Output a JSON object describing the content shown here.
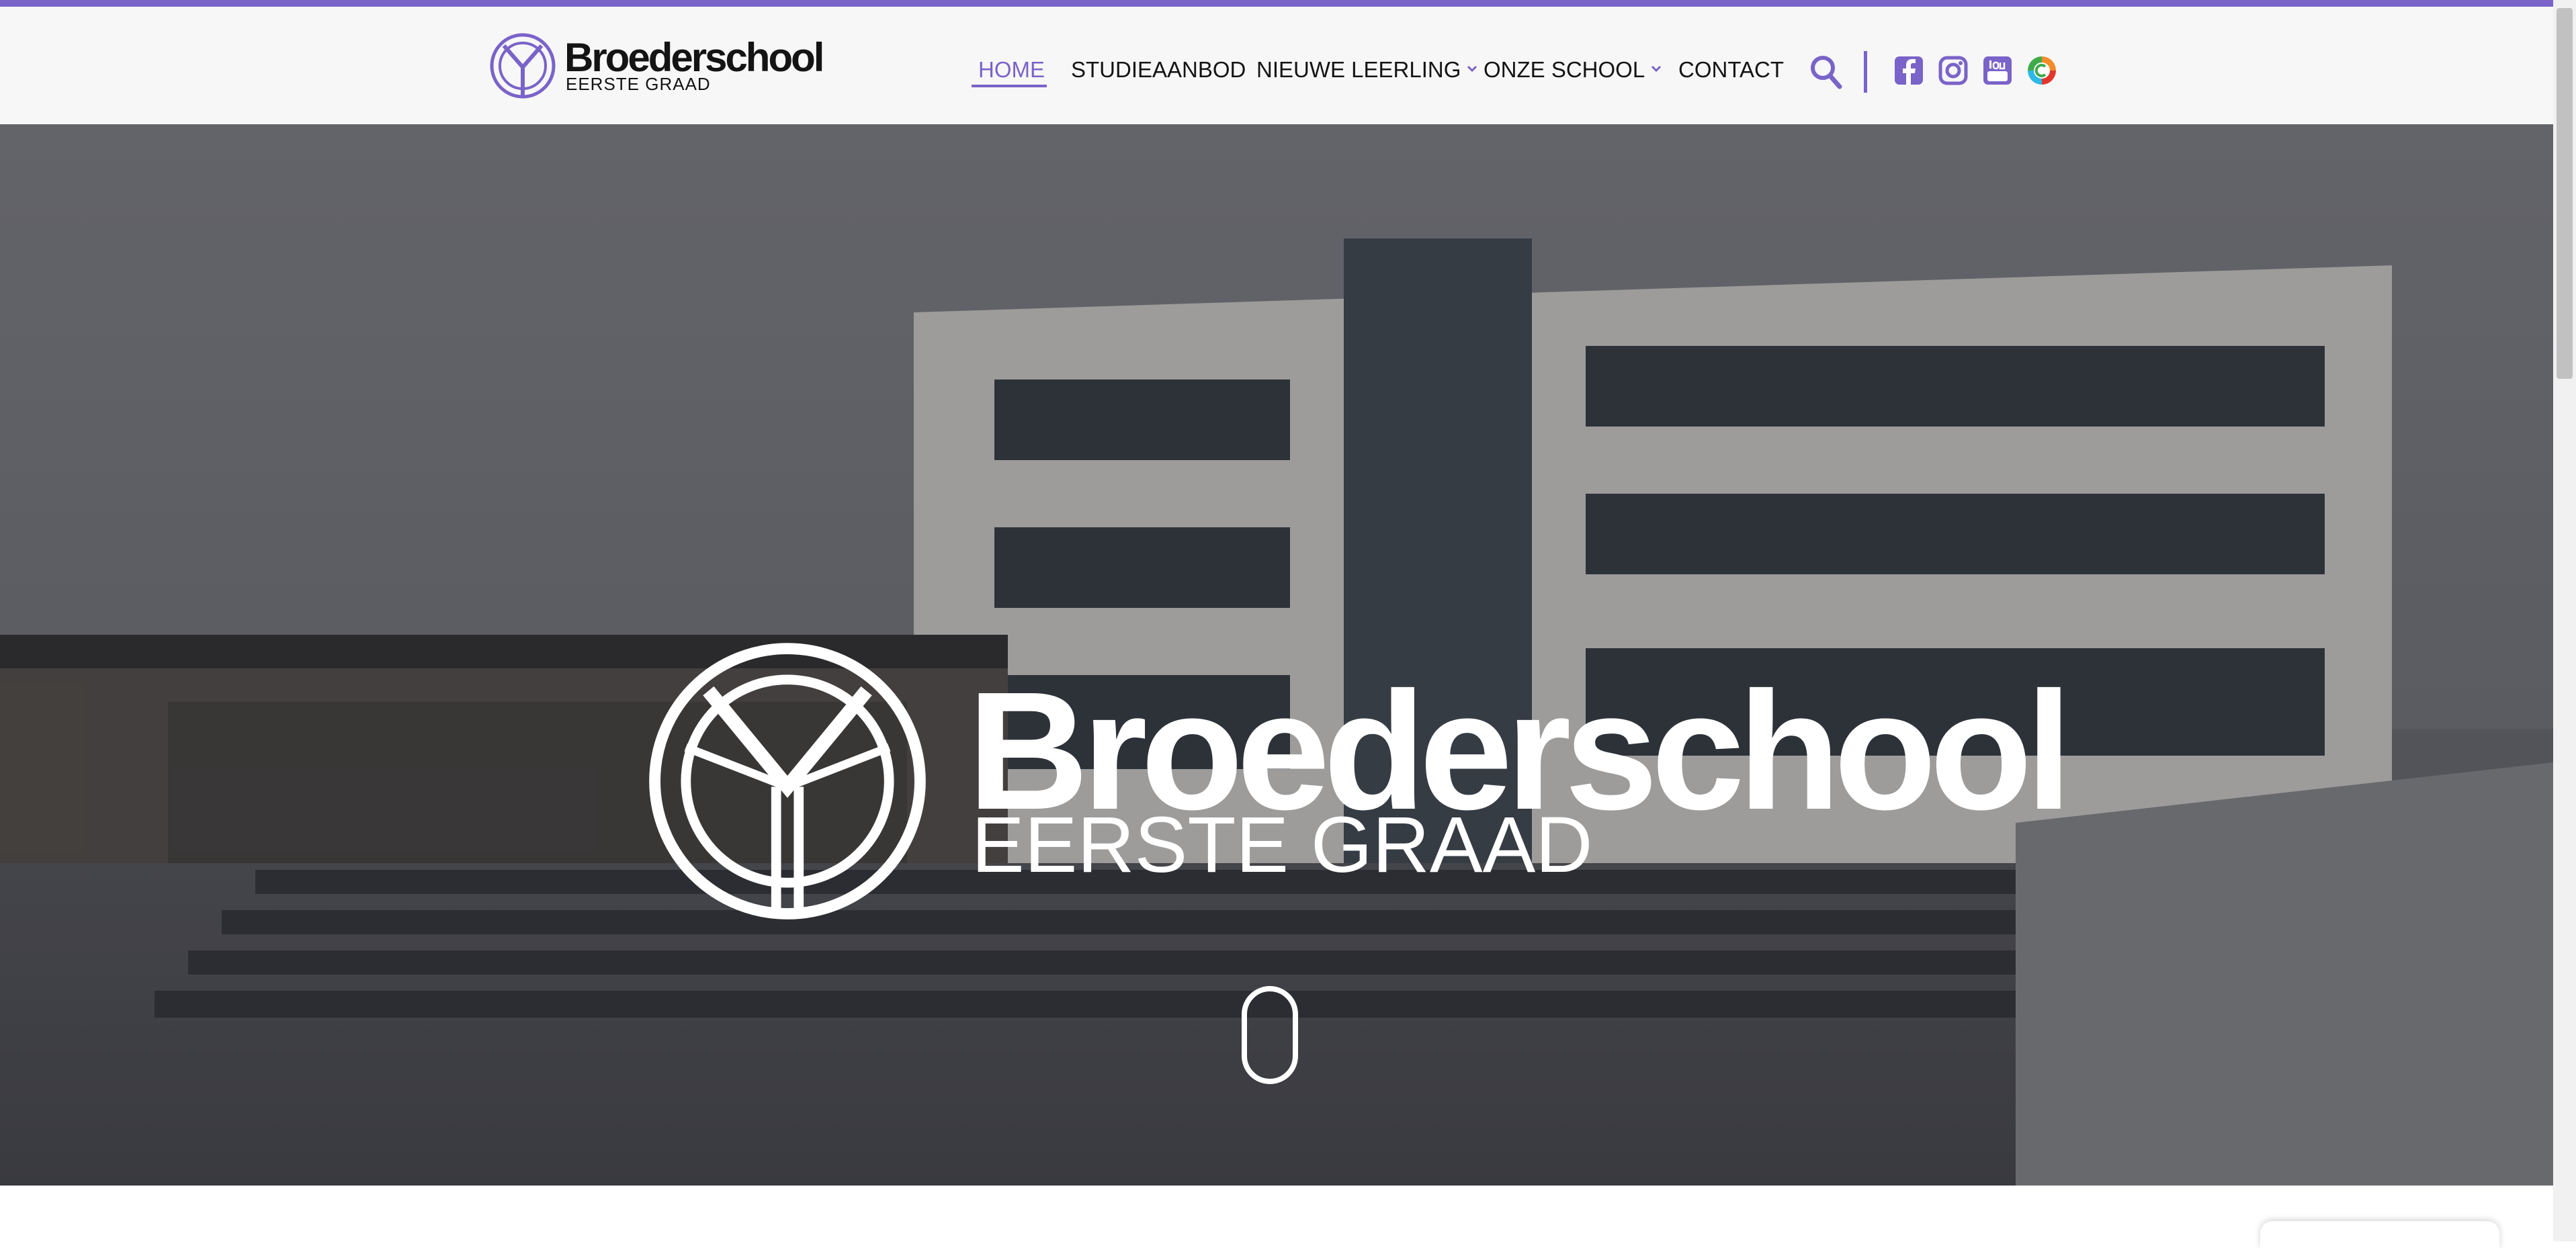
{
  "brand": {
    "name": "Broederschool",
    "subtitle": "EERSTE GRAAD",
    "accent": "#7a63c9"
  },
  "nav": {
    "items": [
      {
        "label": "HOME",
        "active": true,
        "has_dropdown": false
      },
      {
        "label": "STUDIEAANBOD",
        "active": false,
        "has_dropdown": false
      },
      {
        "label": "NIEUWE LEERLING",
        "active": false,
        "has_dropdown": true
      },
      {
        "label": "ONZE SCHOOL",
        "active": false,
        "has_dropdown": true
      },
      {
        "label": "CONTACT",
        "active": false,
        "has_dropdown": false
      }
    ]
  },
  "header_icons": [
    "search-icon",
    "facebook-icon",
    "instagram-icon",
    "youtube-icon",
    "smartschool-icon"
  ],
  "hero": {
    "title": "Broederschool",
    "subtitle": "EERSTE GRAAD",
    "scroll_indicator": "mouse-scroll-icon"
  }
}
